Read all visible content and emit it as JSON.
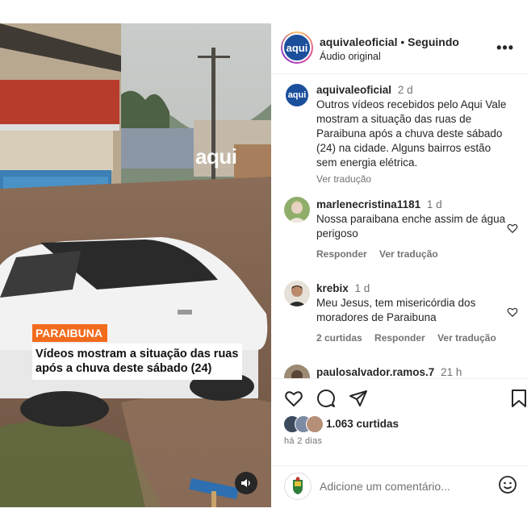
{
  "media": {
    "watermark": "aqui",
    "tag": "PARAIBUNA",
    "headline": "Vídeos mostram a situação das ruas após a chuva deste sábado (24)",
    "audio_icon": "speaker-icon"
  },
  "header": {
    "username": "aquivaleoficial",
    "separator": "•",
    "follow_status": "Seguindo",
    "subtitle": "Áudio original",
    "avatar_text": "aqui",
    "more_icon": "more-options-icon"
  },
  "caption": {
    "username": "aquivaleoficial",
    "time": "2 d",
    "text": "Outros vídeos recebidos pelo Aqui Vale mostram a situação das ruas de Paraibuna após a chuva deste sábado (24) na cidade. Alguns bairros estão sem energia elétrica.",
    "translate": "Ver tradução"
  },
  "comments": [
    {
      "username": "marlenecristina1181",
      "time": "1 d",
      "text": "Nossa paraibana enche assim de água perigoso",
      "reply": "Responder",
      "translate": "Ver tradução"
    },
    {
      "username": "krebix",
      "time": "1 d",
      "text": "Meu Jesus, tem misericórdia dos moradores de Paraibuna",
      "likes": "2 curtidas",
      "reply": "Responder",
      "translate": "Ver tradução"
    },
    {
      "username": "paulosalvador.ramos.7",
      "time": "21 h"
    }
  ],
  "actions": {
    "like_icon": "heart-icon",
    "comment_icon": "comment-icon",
    "share_icon": "share-icon",
    "save_icon": "bookmark-icon",
    "likes": "1.063 curtidas",
    "ago": "há 2 dias"
  },
  "add_comment": {
    "placeholder": "Adicione um comentário...",
    "emoji_icon": "emoji-icon"
  },
  "colors": {
    "brand_blue": "#1b4f9c",
    "tag_orange": "#f26b1d",
    "muted": "#737373"
  }
}
